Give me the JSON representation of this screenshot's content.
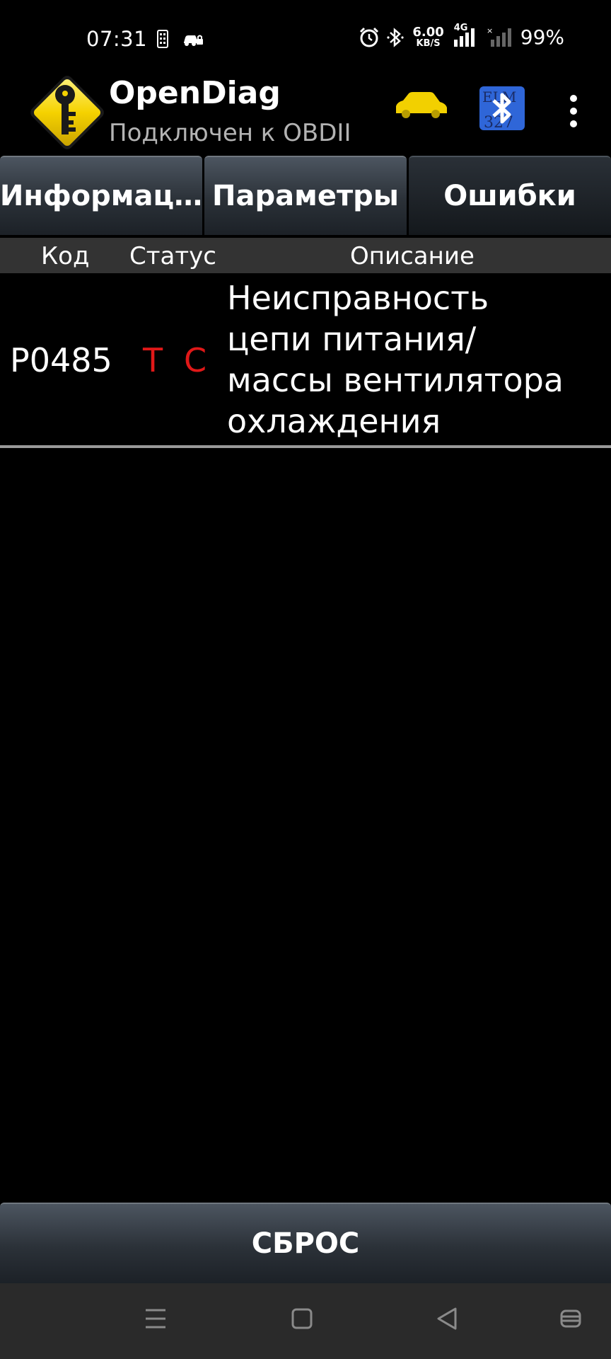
{
  "status_bar": {
    "time": "07:31",
    "net_speed_value": "6.00",
    "net_speed_unit": "KB/S",
    "network_type": "4G",
    "battery": "99%",
    "icons": [
      "sim-icon",
      "car-lock-icon",
      "alarm-icon",
      "bluetooth-icon",
      "signal-icon",
      "signal-off-icon"
    ]
  },
  "action_bar": {
    "title": "OpenDiag",
    "subtitle": "Подключен к OBDII",
    "icons": [
      "opendiag-logo",
      "car-icon",
      "elm327-bluetooth-icon",
      "overflow-menu-icon"
    ],
    "bt_label_top": "ELM",
    "bt_label_bottom": "327"
  },
  "tabs": [
    {
      "label": "Информац…",
      "active": false
    },
    {
      "label": "Параметры",
      "active": false
    },
    {
      "label": "Ошибки",
      "active": true
    }
  ],
  "table": {
    "columns": [
      "Код",
      "Статус",
      "Описание"
    ],
    "rows": [
      {
        "code": "P0485",
        "status": [
          "T",
          "C"
        ],
        "description_lines": [
          "Неисправность",
          "цепи питания/",
          "массы вентилятора",
          "охлаждения"
        ]
      }
    ]
  },
  "reset_button": {
    "label": "СБРОС"
  },
  "nav_bar": {
    "buttons": [
      "menu-nav-icon",
      "home-nav-icon",
      "back-nav-icon",
      "assistant-nav-icon"
    ]
  },
  "colors": {
    "status_red": "#e01818",
    "car_yellow": "#f2d000",
    "bt_blue": "#2f66d8"
  }
}
